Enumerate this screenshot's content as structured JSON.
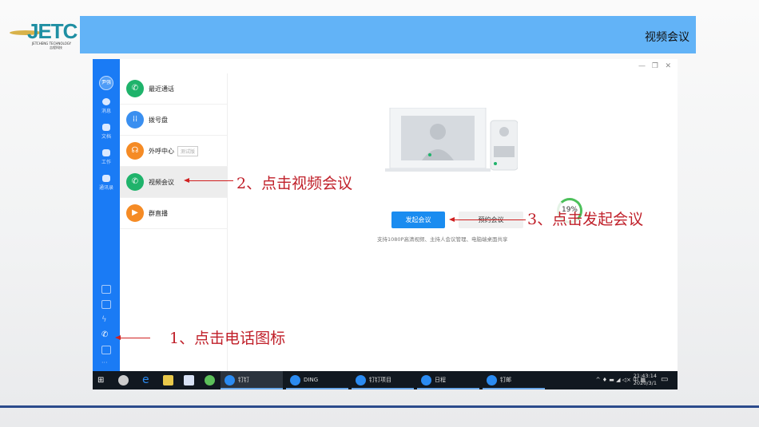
{
  "logo": {
    "text": "JETC",
    "subtitle": "JETCHENG TECHNOLOGY",
    "cn": "吉程科技"
  },
  "header": {
    "title": "视频会议"
  },
  "app": {
    "avatar": "尹强",
    "sidebar": [
      {
        "label": "消息"
      },
      {
        "label": "文档"
      },
      {
        "label": "工作"
      },
      {
        "label": "通讯录"
      }
    ],
    "sidebar_bottom_icons": [
      "calendar-icon",
      "todo-icon",
      "ding-icon",
      "phone-icon",
      "mail-icon",
      "more-icon"
    ],
    "list": [
      {
        "label": "最近通话",
        "color": "#1fb36b"
      },
      {
        "label": "拨号盘",
        "color": "#3a8ff0"
      },
      {
        "label": "外呼中心",
        "tag": "测试版",
        "color": "#f58b25"
      },
      {
        "label": "视频会议",
        "color": "#1fb36b",
        "selected": true
      },
      {
        "label": "群直播",
        "color": "#f58b25"
      }
    ],
    "start_button": "发起会议",
    "schedule_button": "预约会议",
    "description": "支持1080P高清视频、主持人会议管理、电脑端桌面共享",
    "progress": {
      "label": "19%",
      "value": 19
    }
  },
  "taskbar": {
    "apps": [
      "钉钉",
      "DING",
      "钉钉项目",
      "日程",
      "钉邮"
    ],
    "ime": "中",
    "time": "21:43:14",
    "date": "2020/3/1"
  },
  "annotations": {
    "step1": "1、点击电话图标",
    "step2": "2、点击视频会议",
    "step3": "3、点击发起会议"
  }
}
